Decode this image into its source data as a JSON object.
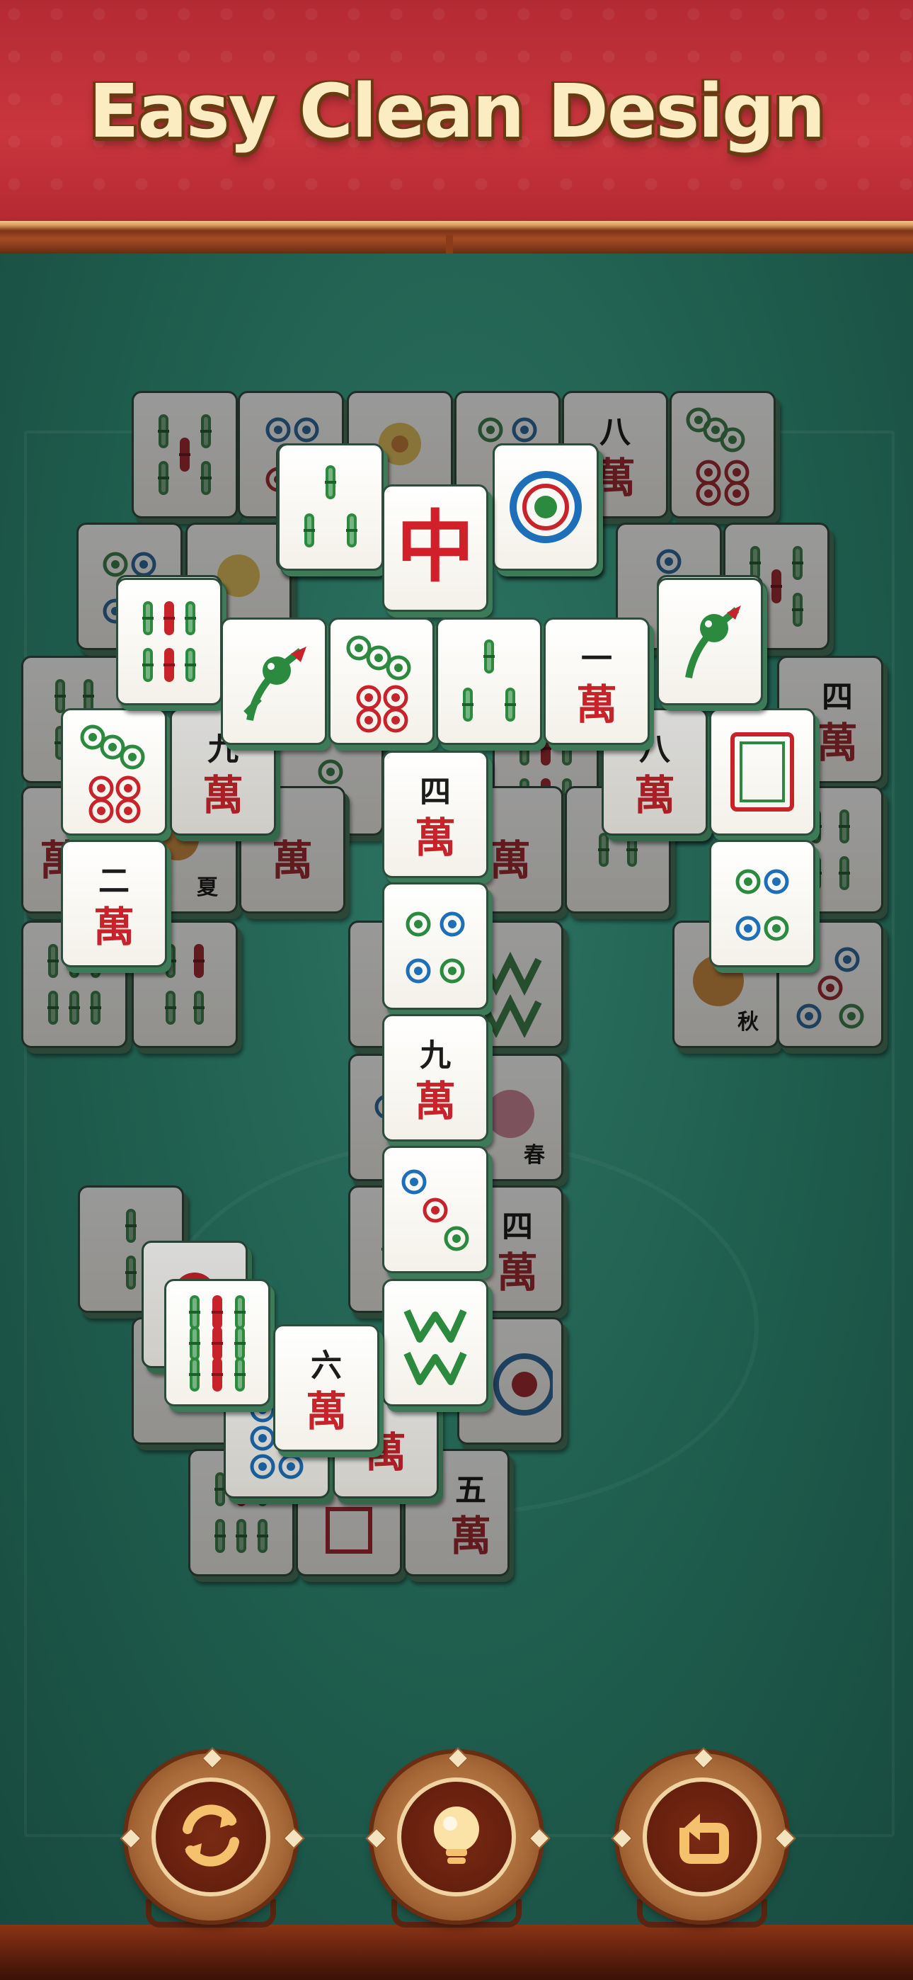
{
  "banner": {
    "title": "Easy Clean Design"
  },
  "colors": {
    "banner_red": "#c9363d",
    "felt_green": "#1f5f4f",
    "tile_face": "#f3f1e8",
    "tile_edge": "#3c7a58",
    "wan_red": "#c8232b",
    "bamboo_green": "#2b8a3e",
    "dot_blue": "#1c6fb8",
    "title_cream": "#fbecc2"
  },
  "tiles": {
    "top_zhong": {
      "glyph": "中"
    },
    "row_one_wan": {
      "top": "一",
      "bottom": "萬"
    },
    "col_si_wan": {
      "top": "四",
      "bottom": "萬"
    },
    "col_jiu_wan": {
      "top": "九",
      "bottom": "萬"
    },
    "left_er_wan": {
      "top": "二",
      "bottom": "萬"
    },
    "bottom_liu_wan": {
      "top": "六",
      "bottom": "萬"
    },
    "back_ba": {
      "top": "八",
      "bottom": "萬"
    },
    "back_si": {
      "top": "四",
      "bottom": "萬"
    },
    "back_wu": {
      "top": "五",
      "bottom": "萬"
    },
    "back_si_lower": {
      "top": "四",
      "bottom": "萬"
    },
    "season_xia": {
      "label": "夏"
    },
    "season_qiu": {
      "label": "秋"
    },
    "season_chun": {
      "label": "春"
    }
  },
  "controls": [
    {
      "name": "shuffle",
      "icon": "shuffle-icon"
    },
    {
      "name": "hint",
      "icon": "lightbulb-icon"
    },
    {
      "name": "undo",
      "icon": "undo-icon"
    }
  ]
}
